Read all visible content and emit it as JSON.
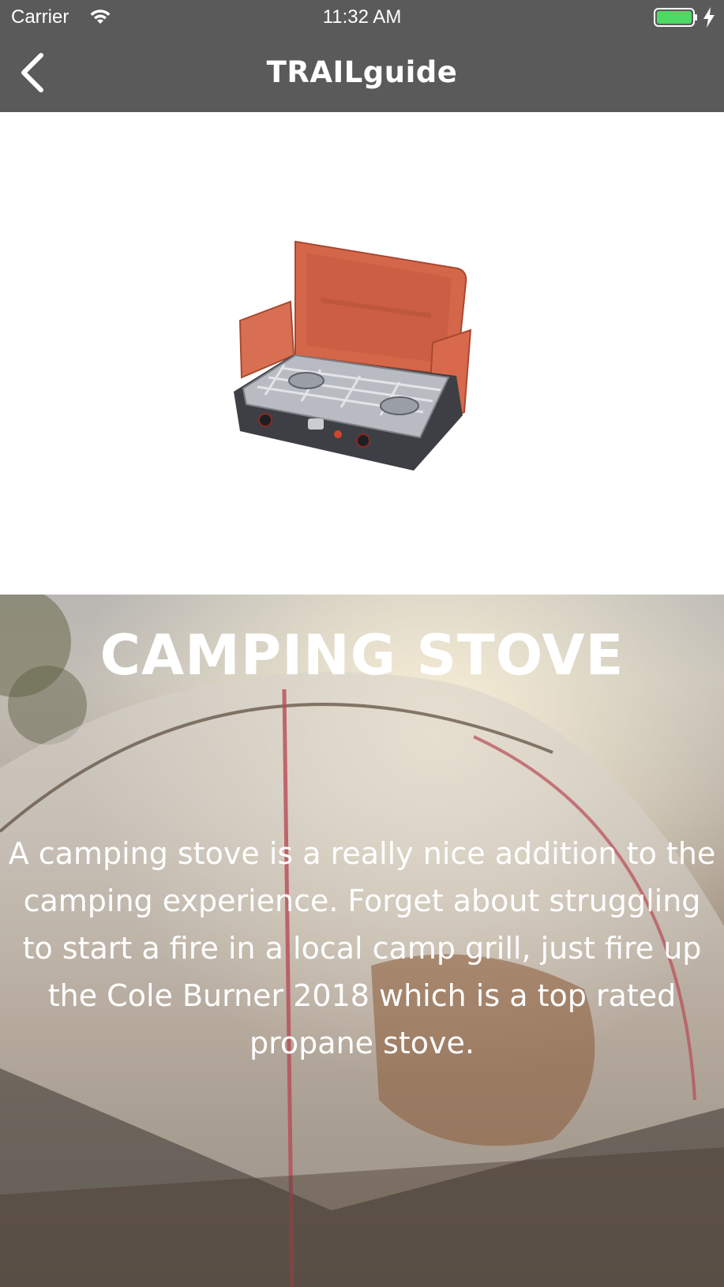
{
  "status_bar": {
    "carrier": "Carrier",
    "time": "11:32 AM",
    "battery_icon": "battery-full-charging-icon"
  },
  "nav_bar": {
    "title": "TRAILguide",
    "back_icon": "chevron-left-icon"
  },
  "product": {
    "image": "camping-stove-image"
  },
  "detail": {
    "title": "CAMPING STOVE",
    "description": "A camping stove is a really nice addition to the camping experience. Forget about struggling to start a fire in a local camp grill, just fire up the Cole Burner 2018 which is a top rated propane stove.",
    "background_image": "tent-campsite-photo"
  },
  "colors": {
    "bar_background": "#5a5a5a",
    "stove_orange": "#d4674a",
    "battery_green": "#4cd964"
  }
}
